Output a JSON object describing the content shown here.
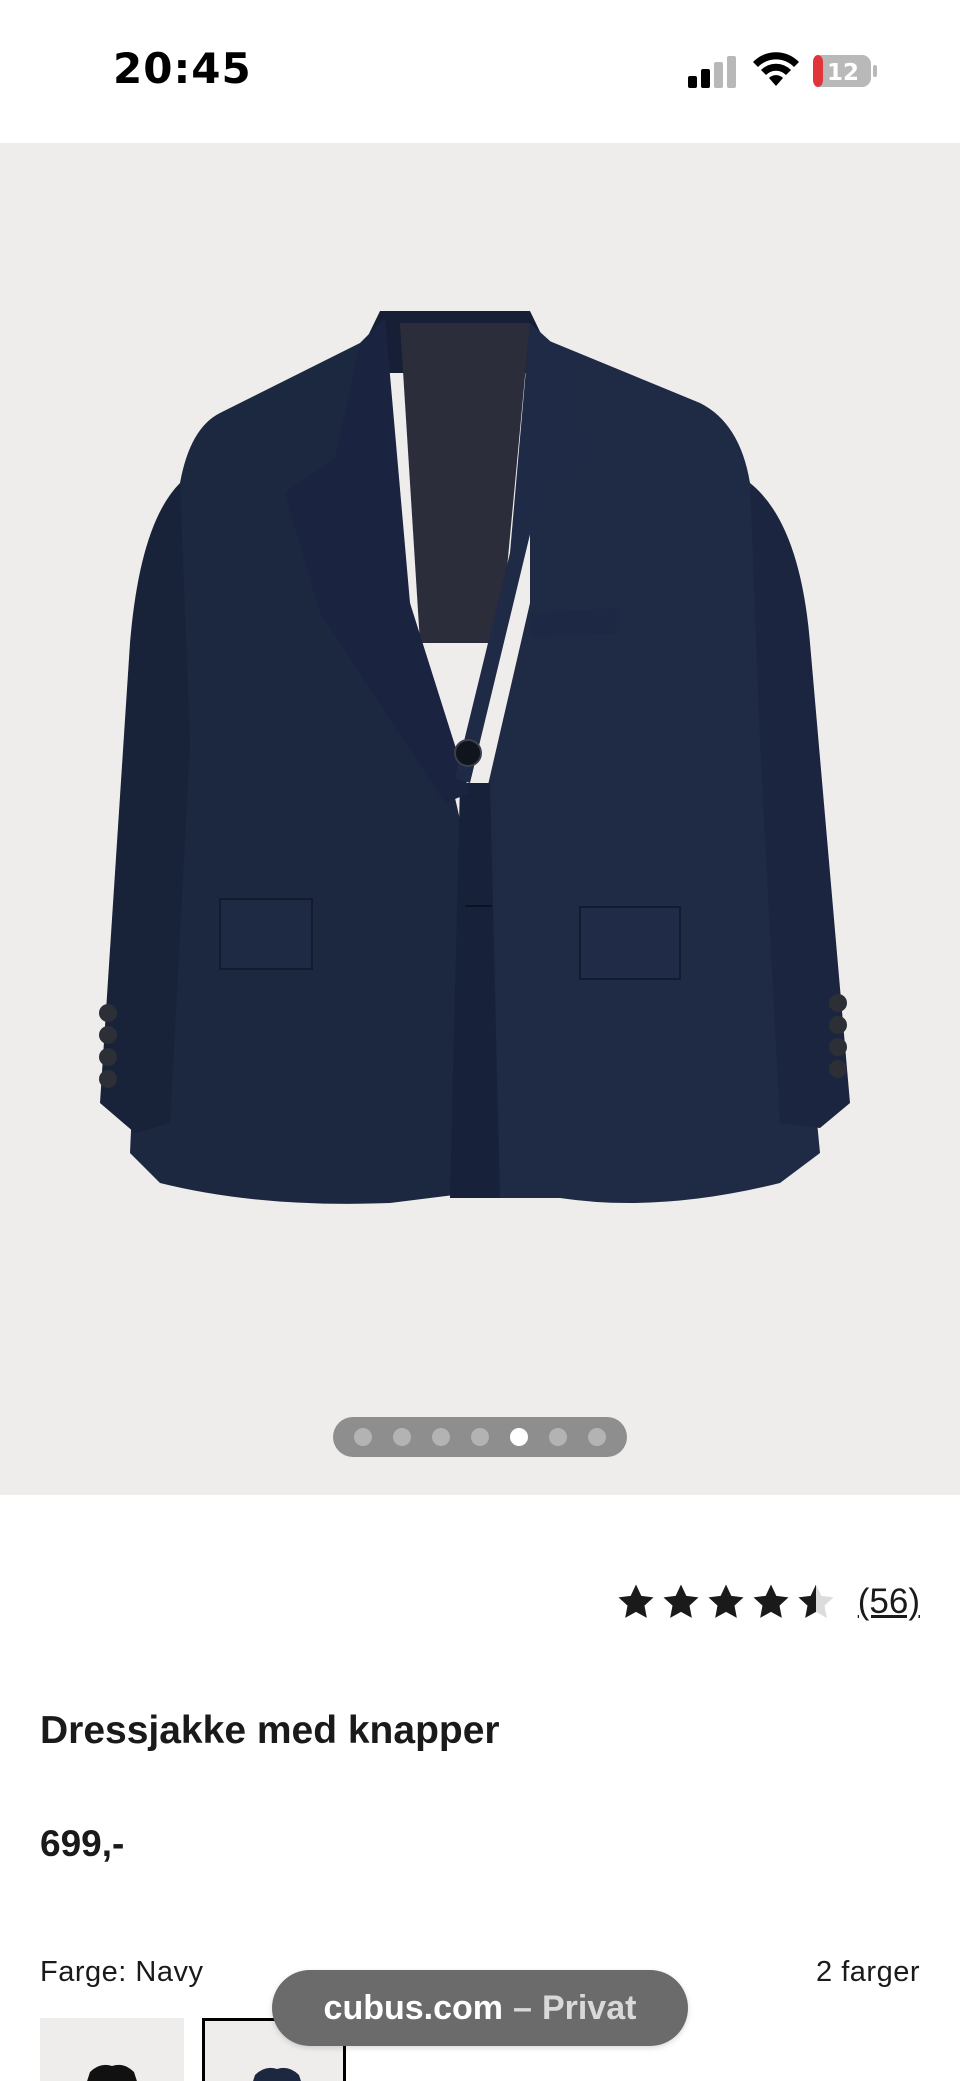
{
  "status_bar": {
    "time": "20:45",
    "battery_level": "12",
    "icons": [
      "cellular-signal-icon",
      "wifi-icon",
      "battery-icon"
    ]
  },
  "gallery": {
    "image": "navy-suit-jacket",
    "page_count": 7,
    "active_page": 5
  },
  "rating": {
    "stars": 4.5,
    "review_count": "(56)"
  },
  "product": {
    "title": "Dressjakke med knapper",
    "price": "699,-"
  },
  "color": {
    "label": "Farge: Navy",
    "count": "2 farger"
  },
  "browser": {
    "domain": "cubus.com",
    "separator": "–",
    "mode": "Privat"
  },
  "colors": {
    "jacket": "#1c2740",
    "image_bg": "#efedec",
    "pill_bg": "#6b6b6b",
    "battery_low": "#e0353b"
  }
}
